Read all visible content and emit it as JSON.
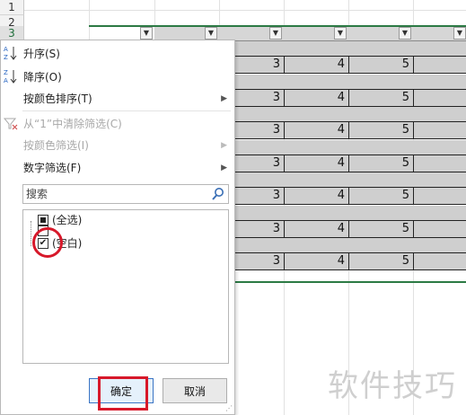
{
  "sheet": {
    "row_numbers": [
      "1",
      "2",
      "3"
    ],
    "data_rows": [
      [
        "3",
        "4",
        "5"
      ],
      [
        "3",
        "4",
        "5"
      ],
      [
        "3",
        "4",
        "5"
      ],
      [
        "3",
        "4",
        "5"
      ],
      [
        "3",
        "4",
        "5"
      ],
      [
        "3",
        "4",
        "5"
      ],
      [
        "3",
        "4",
        "5"
      ]
    ],
    "filter_glyph": "▼",
    "header_green": "#2c7a44",
    "selection_gray": "#d0d0d0"
  },
  "menu": {
    "sort_asc": {
      "label": "升序(S)",
      "icon": "sort-ascending-icon"
    },
    "sort_desc": {
      "label": "降序(O)",
      "icon": "sort-descending-icon"
    },
    "sort_by_color": {
      "label": "按颜色排序(T)",
      "has_submenu": true
    },
    "clear_filter": {
      "label": "从“1”中清除筛选(C)",
      "disabled": true,
      "icon": "clear-filter-icon"
    },
    "filter_by_color": {
      "label": "按颜色筛选(I)",
      "disabled": true,
      "has_submenu": true
    },
    "number_filter": {
      "label": "数字筛选(F)",
      "has_submenu": true
    },
    "search": {
      "placeholder": "搜索",
      "icon": "search-icon"
    },
    "list": [
      {
        "label": "(全选)",
        "state": "partial"
      },
      {
        "label": "",
        "state": "unchecked"
      },
      {
        "label": "(空白)",
        "state": "checked"
      }
    ],
    "ok_label": "确定",
    "cancel_label": "取消",
    "submenu_arrow": "▶"
  },
  "watermark": "软件技巧",
  "annotations": {
    "highlight_color": "#d7182a"
  }
}
